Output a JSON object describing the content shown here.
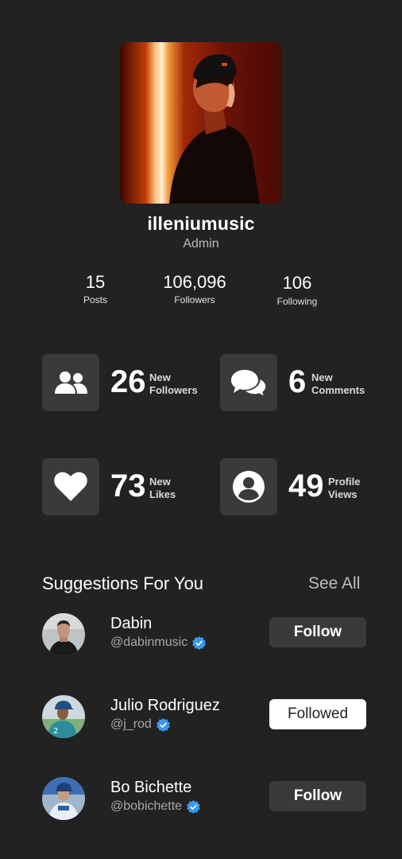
{
  "profile": {
    "username": "illeniumusic",
    "role": "Admin"
  },
  "stats": [
    {
      "value": "15",
      "label": "Posts"
    },
    {
      "value": "106,096",
      "label": "Followers"
    },
    {
      "value": "106",
      "label": "Following"
    }
  ],
  "activity": [
    {
      "value": "26",
      "label": "New\nFollowers",
      "icon": "users-icon"
    },
    {
      "value": "6",
      "label": "New\nComments",
      "icon": "comments-icon"
    },
    {
      "value": "73",
      "label": "New\nLikes",
      "icon": "heart-icon"
    },
    {
      "value": "49",
      "label": "Profile\nViews",
      "icon": "user-circle-icon"
    }
  ],
  "suggestions": {
    "title": "Suggestions For You",
    "see_all": "See All",
    "items": [
      {
        "name": "Dabin",
        "handle": "@dabinmusic",
        "button": "Follow",
        "state": "follow"
      },
      {
        "name": "Julio Rodriguez",
        "handle": "@j_rod",
        "button": "Followed",
        "state": "followed"
      },
      {
        "name": "Bo Bichette",
        "handle": "@bobichette",
        "button": "Follow",
        "state": "follow"
      }
    ]
  },
  "colors": {
    "background": "#222222",
    "tile": "#3a3a3a",
    "verified": "#3897f0",
    "muted": "#bdbdbd"
  }
}
